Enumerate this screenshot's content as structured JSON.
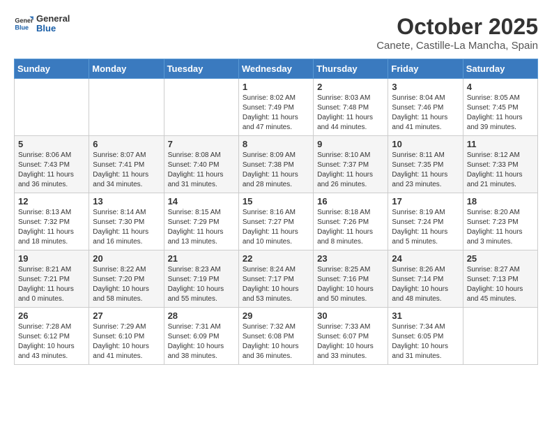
{
  "logo": {
    "general": "General",
    "blue": "Blue"
  },
  "title": "October 2025",
  "subtitle": "Canete, Castille-La Mancha, Spain",
  "weekdays": [
    "Sunday",
    "Monday",
    "Tuesday",
    "Wednesday",
    "Thursday",
    "Friday",
    "Saturday"
  ],
  "weeks": [
    [
      {
        "day": "",
        "info": ""
      },
      {
        "day": "",
        "info": ""
      },
      {
        "day": "",
        "info": ""
      },
      {
        "day": "1",
        "info": "Sunrise: 8:02 AM\nSunset: 7:49 PM\nDaylight: 11 hours\nand 47 minutes."
      },
      {
        "day": "2",
        "info": "Sunrise: 8:03 AM\nSunset: 7:48 PM\nDaylight: 11 hours\nand 44 minutes."
      },
      {
        "day": "3",
        "info": "Sunrise: 8:04 AM\nSunset: 7:46 PM\nDaylight: 11 hours\nand 41 minutes."
      },
      {
        "day": "4",
        "info": "Sunrise: 8:05 AM\nSunset: 7:45 PM\nDaylight: 11 hours\nand 39 minutes."
      }
    ],
    [
      {
        "day": "5",
        "info": "Sunrise: 8:06 AM\nSunset: 7:43 PM\nDaylight: 11 hours\nand 36 minutes."
      },
      {
        "day": "6",
        "info": "Sunrise: 8:07 AM\nSunset: 7:41 PM\nDaylight: 11 hours\nand 34 minutes."
      },
      {
        "day": "7",
        "info": "Sunrise: 8:08 AM\nSunset: 7:40 PM\nDaylight: 11 hours\nand 31 minutes."
      },
      {
        "day": "8",
        "info": "Sunrise: 8:09 AM\nSunset: 7:38 PM\nDaylight: 11 hours\nand 28 minutes."
      },
      {
        "day": "9",
        "info": "Sunrise: 8:10 AM\nSunset: 7:37 PM\nDaylight: 11 hours\nand 26 minutes."
      },
      {
        "day": "10",
        "info": "Sunrise: 8:11 AM\nSunset: 7:35 PM\nDaylight: 11 hours\nand 23 minutes."
      },
      {
        "day": "11",
        "info": "Sunrise: 8:12 AM\nSunset: 7:33 PM\nDaylight: 11 hours\nand 21 minutes."
      }
    ],
    [
      {
        "day": "12",
        "info": "Sunrise: 8:13 AM\nSunset: 7:32 PM\nDaylight: 11 hours\nand 18 minutes."
      },
      {
        "day": "13",
        "info": "Sunrise: 8:14 AM\nSunset: 7:30 PM\nDaylight: 11 hours\nand 16 minutes."
      },
      {
        "day": "14",
        "info": "Sunrise: 8:15 AM\nSunset: 7:29 PM\nDaylight: 11 hours\nand 13 minutes."
      },
      {
        "day": "15",
        "info": "Sunrise: 8:16 AM\nSunset: 7:27 PM\nDaylight: 11 hours\nand 10 minutes."
      },
      {
        "day": "16",
        "info": "Sunrise: 8:18 AM\nSunset: 7:26 PM\nDaylight: 11 hours\nand 8 minutes."
      },
      {
        "day": "17",
        "info": "Sunrise: 8:19 AM\nSunset: 7:24 PM\nDaylight: 11 hours\nand 5 minutes."
      },
      {
        "day": "18",
        "info": "Sunrise: 8:20 AM\nSunset: 7:23 PM\nDaylight: 11 hours\nand 3 minutes."
      }
    ],
    [
      {
        "day": "19",
        "info": "Sunrise: 8:21 AM\nSunset: 7:21 PM\nDaylight: 11 hours\nand 0 minutes."
      },
      {
        "day": "20",
        "info": "Sunrise: 8:22 AM\nSunset: 7:20 PM\nDaylight: 10 hours\nand 58 minutes."
      },
      {
        "day": "21",
        "info": "Sunrise: 8:23 AM\nSunset: 7:19 PM\nDaylight: 10 hours\nand 55 minutes."
      },
      {
        "day": "22",
        "info": "Sunrise: 8:24 AM\nSunset: 7:17 PM\nDaylight: 10 hours\nand 53 minutes."
      },
      {
        "day": "23",
        "info": "Sunrise: 8:25 AM\nSunset: 7:16 PM\nDaylight: 10 hours\nand 50 minutes."
      },
      {
        "day": "24",
        "info": "Sunrise: 8:26 AM\nSunset: 7:14 PM\nDaylight: 10 hours\nand 48 minutes."
      },
      {
        "day": "25",
        "info": "Sunrise: 8:27 AM\nSunset: 7:13 PM\nDaylight: 10 hours\nand 45 minutes."
      }
    ],
    [
      {
        "day": "26",
        "info": "Sunrise: 7:28 AM\nSunset: 6:12 PM\nDaylight: 10 hours\nand 43 minutes."
      },
      {
        "day": "27",
        "info": "Sunrise: 7:29 AM\nSunset: 6:10 PM\nDaylight: 10 hours\nand 41 minutes."
      },
      {
        "day": "28",
        "info": "Sunrise: 7:31 AM\nSunset: 6:09 PM\nDaylight: 10 hours\nand 38 minutes."
      },
      {
        "day": "29",
        "info": "Sunrise: 7:32 AM\nSunset: 6:08 PM\nDaylight: 10 hours\nand 36 minutes."
      },
      {
        "day": "30",
        "info": "Sunrise: 7:33 AM\nSunset: 6:07 PM\nDaylight: 10 hours\nand 33 minutes."
      },
      {
        "day": "31",
        "info": "Sunrise: 7:34 AM\nSunset: 6:05 PM\nDaylight: 10 hours\nand 31 minutes."
      },
      {
        "day": "",
        "info": ""
      }
    ]
  ]
}
